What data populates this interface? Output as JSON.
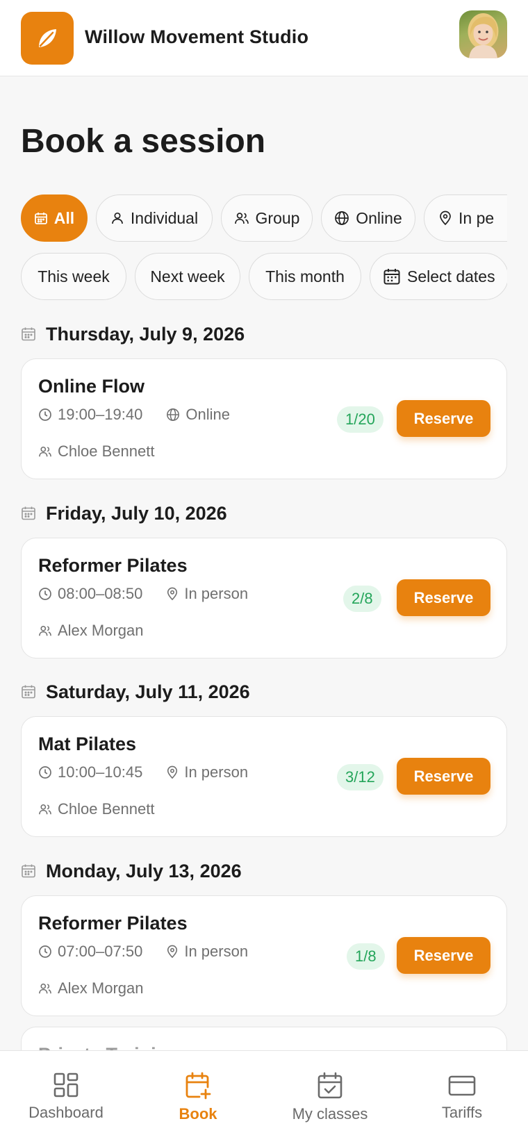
{
  "header": {
    "studio_name": "Willow Movement Studio",
    "logo_icon": "leaf-icon",
    "avatar_icon": "user-avatar"
  },
  "page": {
    "title": "Book a session"
  },
  "type_filters": [
    {
      "label": "All",
      "icon": "calendar-icon",
      "active": true
    },
    {
      "label": "Individual",
      "icon": "person-icon",
      "active": false
    },
    {
      "label": "Group",
      "icon": "group-icon",
      "active": false
    },
    {
      "label": "Online",
      "icon": "globe-icon",
      "active": false
    },
    {
      "label": "In pe",
      "icon": "location-pin-icon",
      "active": false
    }
  ],
  "date_filters": [
    {
      "label": "This week"
    },
    {
      "label": "Next week"
    },
    {
      "label": "This month"
    },
    {
      "label": "Select dates",
      "icon": "calendar-icon"
    }
  ],
  "days": [
    {
      "date": "Thursday, July 9, 2026",
      "session": {
        "name": "Online Flow",
        "time": "19:00–19:40",
        "mode": "Online",
        "mode_icon": "globe-icon",
        "instructor": "Chloe Bennett",
        "capacity": "1/20",
        "action": "Reserve"
      }
    },
    {
      "date": "Friday, July 10, 2026",
      "session": {
        "name": "Reformer Pilates",
        "time": "08:00–08:50",
        "mode": "In person",
        "mode_icon": "location-pin-icon",
        "instructor": "Alex Morgan",
        "capacity": "2/8",
        "action": "Reserve"
      }
    },
    {
      "date": "Saturday, July 11, 2026",
      "session": {
        "name": "Mat Pilates",
        "time": "10:00–10:45",
        "mode": "In person",
        "mode_icon": "location-pin-icon",
        "instructor": "Chloe Bennett",
        "capacity": "3/12",
        "action": "Reserve"
      }
    },
    {
      "date": "Monday, July 13, 2026",
      "session": {
        "name": "Reformer Pilates",
        "time": "07:00–07:50",
        "mode": "In person",
        "mode_icon": "location-pin-icon",
        "instructor": "Alex Morgan",
        "capacity": "1/8",
        "action": "Reserve"
      }
    }
  ],
  "peek": {
    "name": "Private Training"
  },
  "nav": [
    {
      "label": "Dashboard",
      "icon": "dashboard-icon",
      "active": false
    },
    {
      "label": "Book",
      "icon": "calendar-plus-icon",
      "active": true
    },
    {
      "label": "My classes",
      "icon": "calendar-check-icon",
      "active": false
    },
    {
      "label": "Tariffs",
      "icon": "card-icon",
      "active": false
    }
  ],
  "colors": {
    "accent": "#e8820f",
    "capacity_bg": "#e3f6ea",
    "capacity_text": "#24a55a"
  }
}
